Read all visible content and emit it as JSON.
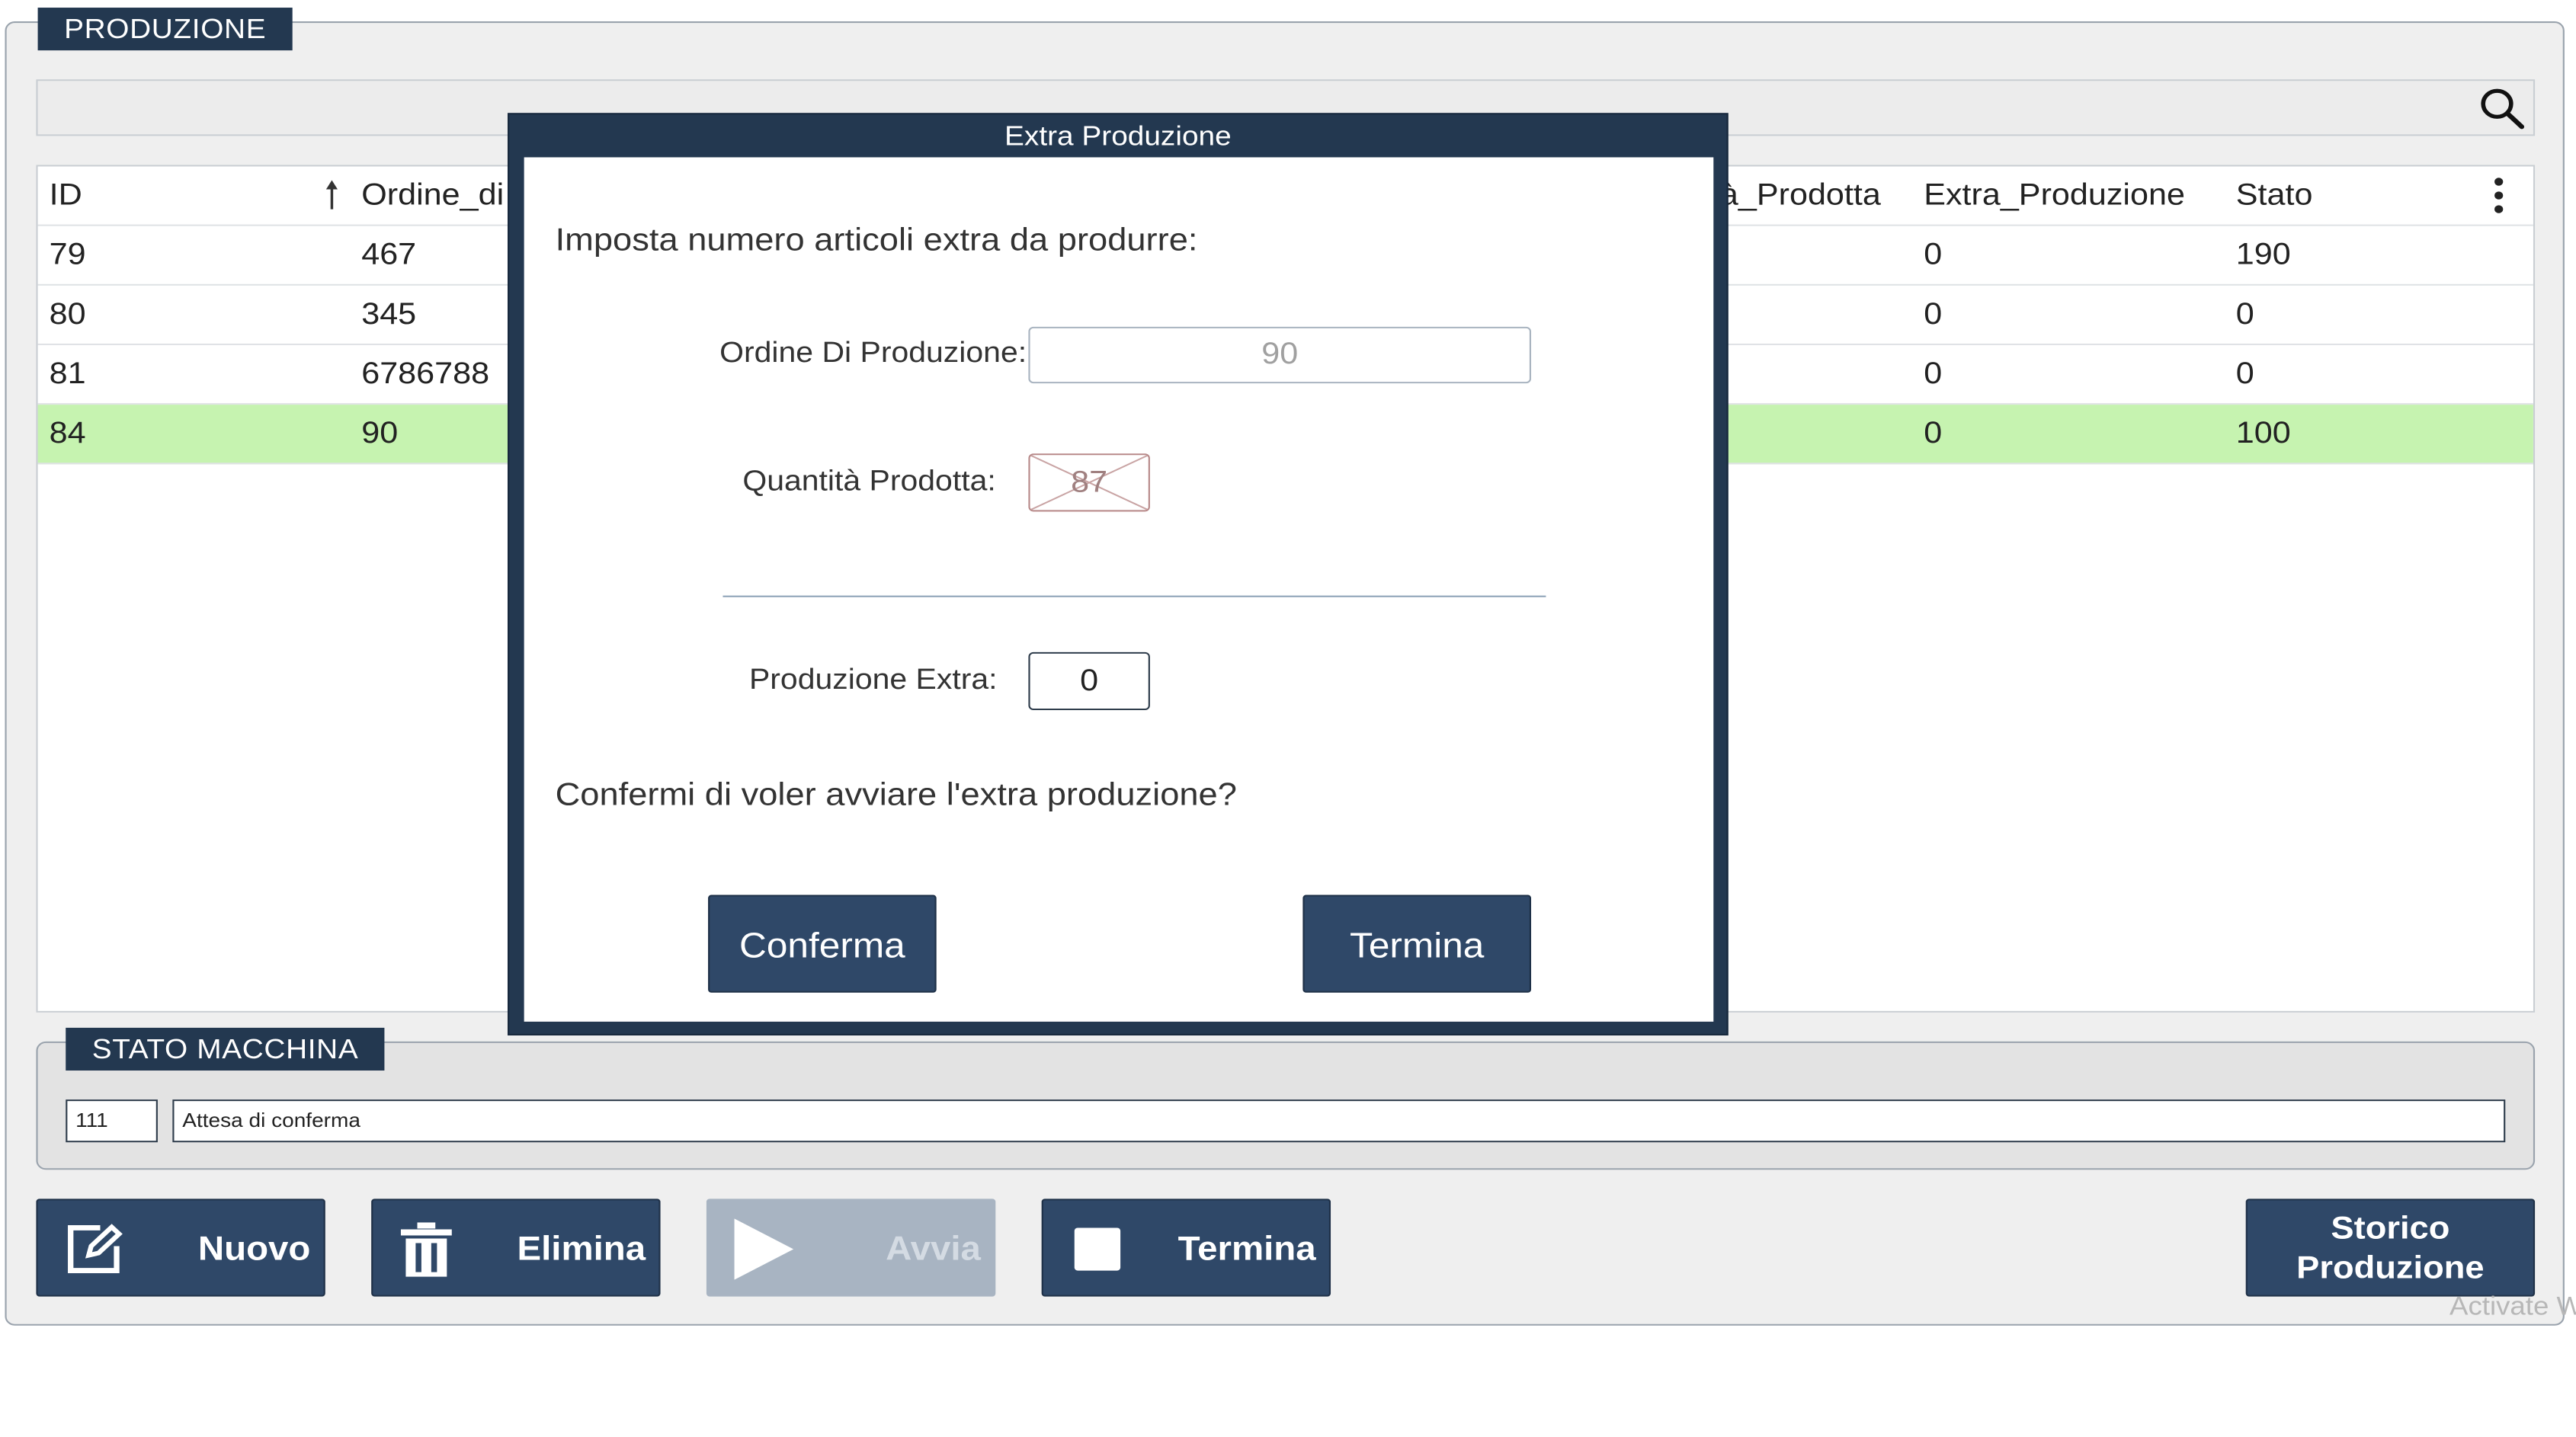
{
  "production": {
    "section_title": "PRODUZIONE",
    "search": {
      "value": "",
      "icon": "search-icon"
    },
    "table": {
      "columns": [
        "ID",
        "Ordine_di",
        "à_Prodotta",
        "Extra_Produzione",
        "Stato"
      ],
      "rows": [
        {
          "id": "79",
          "ordine": "467",
          "extra": "0",
          "stato": "190",
          "selected": false
        },
        {
          "id": "80",
          "ordine": "345",
          "extra": "0",
          "stato": "0",
          "selected": false
        },
        {
          "id": "81",
          "ordine": "6786788",
          "extra": "0",
          "stato": "0",
          "selected": false
        },
        {
          "id": "84",
          "ordine": "90",
          "extra": "0",
          "stato": "100",
          "selected": true
        }
      ]
    }
  },
  "machine_state": {
    "section_title": "STATO MACCHINA",
    "code": "111",
    "description": "Attesa di conferma"
  },
  "toolbar": {
    "new_label": "Nuovo",
    "delete_label": "Elimina",
    "start_label": "Avvia",
    "stop_label": "Termina",
    "history_label_line1": "Storico",
    "history_label_line2": "Produzione"
  },
  "watermark": "Activate W",
  "dialog": {
    "title": "Extra Produzione",
    "prompt": "Imposta numero articoli extra da produrre:",
    "order_label": "Ordine Di Produzione:",
    "order_value": "90",
    "qty_label": "Quantità Prodotta:",
    "qty_value": "87",
    "extra_label": "Produzione Extra:",
    "extra_value": "0",
    "question": "Confermi di voler avviare l'extra produzione?",
    "confirm_label": "Conferma",
    "cancel_label": "Termina"
  },
  "colors": {
    "primary": "#2f4868",
    "header": "#233850",
    "selected_row": "#c6f3b0",
    "disabled": "#a8b4c2"
  }
}
